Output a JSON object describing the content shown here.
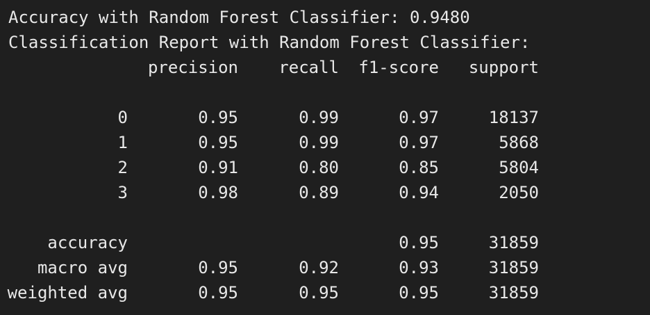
{
  "accuracy_line": "Accuracy with Random Forest Classifier: 0.9480",
  "report_title": "Classification Report with Random Forest Classifier:",
  "headers": {
    "precision": "precision",
    "recall": "recall",
    "f1": "f1-score",
    "support": "support"
  },
  "class_rows": [
    {
      "label": "0",
      "precision": "0.95",
      "recall": "0.99",
      "f1": "0.97",
      "support": "18137"
    },
    {
      "label": "1",
      "precision": "0.95",
      "recall": "0.99",
      "f1": "0.97",
      "support": "5868"
    },
    {
      "label": "2",
      "precision": "0.91",
      "recall": "0.80",
      "f1": "0.85",
      "support": "5804"
    },
    {
      "label": "3",
      "precision": "0.98",
      "recall": "0.89",
      "f1": "0.94",
      "support": "2050"
    }
  ],
  "summary_rows": [
    {
      "label": "accuracy",
      "precision": "",
      "recall": "",
      "f1": "0.95",
      "support": "31859"
    },
    {
      "label": "macro avg",
      "precision": "0.95",
      "recall": "0.92",
      "f1": "0.93",
      "support": "31859"
    },
    {
      "label": "weighted avg",
      "precision": "0.95",
      "recall": "0.95",
      "f1": "0.95",
      "support": "31859"
    }
  ]
}
